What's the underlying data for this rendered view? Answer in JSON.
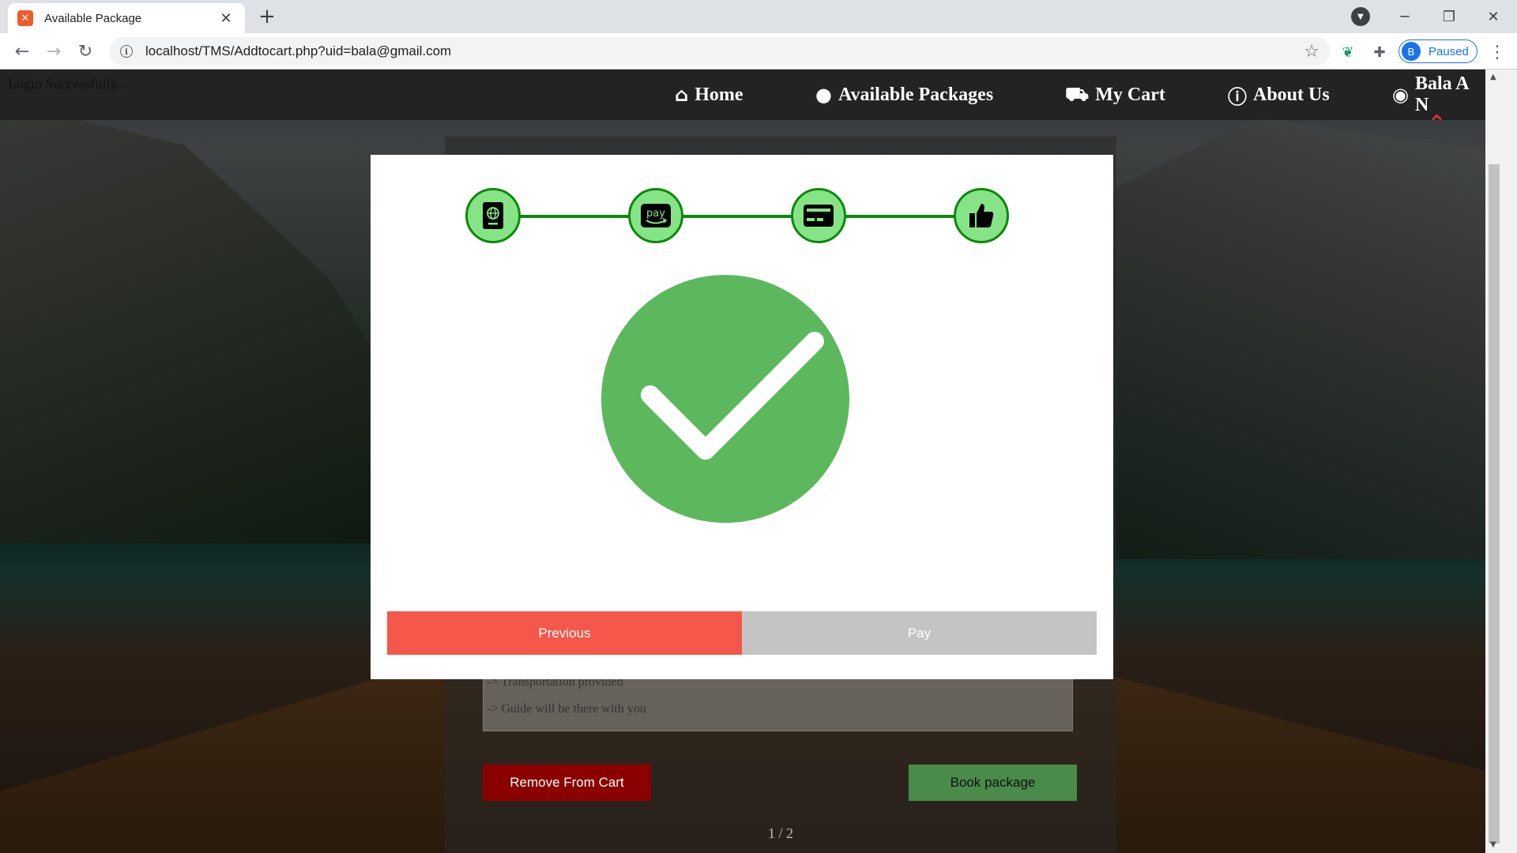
{
  "browser": {
    "tab_title": "Available Package",
    "tab_favicon": "xampp-icon",
    "url": "localhost/TMS/Addtocart.php?uid=bala@gmail.com",
    "profile_initial": "B",
    "profile_status": "Paused"
  },
  "page": {
    "login_message": "Login Successfully...",
    "nav": [
      {
        "label": "Home",
        "icon": "home-icon"
      },
      {
        "label": "Available Packages",
        "icon": "globe-icon"
      },
      {
        "label": "My Cart",
        "icon": "cart-icon"
      },
      {
        "label": "About Us",
        "icon": "info-icon"
      },
      {
        "label": "Bala A N",
        "icon": "user-circle-icon"
      }
    ],
    "package_card": {
      "description_lines": [
        "-> Transportation provided",
        "-> Guide will be there with you"
      ],
      "remove_label": "Remove From Cart",
      "book_label": "Book package",
      "pager": "1 / 2"
    }
  },
  "modal": {
    "steps": [
      {
        "icon": "passport-icon",
        "state": "complete"
      },
      {
        "icon": "amazon-pay-icon",
        "state": "complete"
      },
      {
        "icon": "credit-card-icon",
        "state": "complete"
      },
      {
        "icon": "thumbs-up-icon",
        "state": "complete"
      }
    ],
    "success_icon": "checkmark-icon",
    "previous_label": "Previous",
    "pay_label": "Pay"
  },
  "colors": {
    "step_fill": "#86e486",
    "step_border": "#0b8a0b",
    "success_green": "#5cb85c",
    "previous_red": "#f5574a",
    "pay_disabled": "#c4c4c4",
    "remove_red": "#8b0000",
    "book_green": "#4a8a4a"
  }
}
